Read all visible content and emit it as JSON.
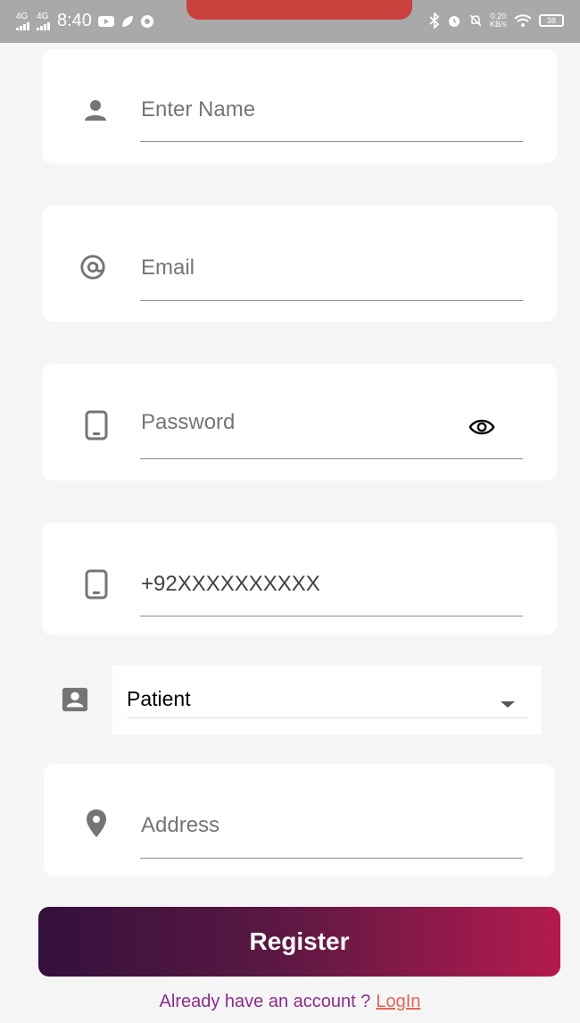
{
  "status_bar": {
    "network_1": "4G",
    "network_2": "4G",
    "time": "8:40",
    "speed_value": "0.20",
    "speed_unit": "KB/s",
    "battery": "38"
  },
  "form": {
    "name": {
      "placeholder": "Enter Name",
      "icon": "person-icon"
    },
    "email": {
      "placeholder": "Email",
      "icon": "at-icon"
    },
    "password": {
      "placeholder": "Password",
      "icon": "phone-icon",
      "toggle_icon": "eye-icon"
    },
    "phone": {
      "value": "+92XXXXXXXXXX",
      "icon": "phone-icon"
    },
    "role": {
      "selected": "Patient",
      "icon": "badge-icon"
    },
    "address": {
      "placeholder": "Address",
      "icon": "location-pin-icon"
    }
  },
  "actions": {
    "register_label": "Register",
    "login_prompt": "Already have an account ?",
    "login_link": "LogIn"
  },
  "colors": {
    "button_gradient_start": "#34103c",
    "button_gradient_end": "#b41a4e",
    "prompt_text": "#8e2b8c",
    "link_text": "#e5665b",
    "status_notch": "#c9413c"
  }
}
